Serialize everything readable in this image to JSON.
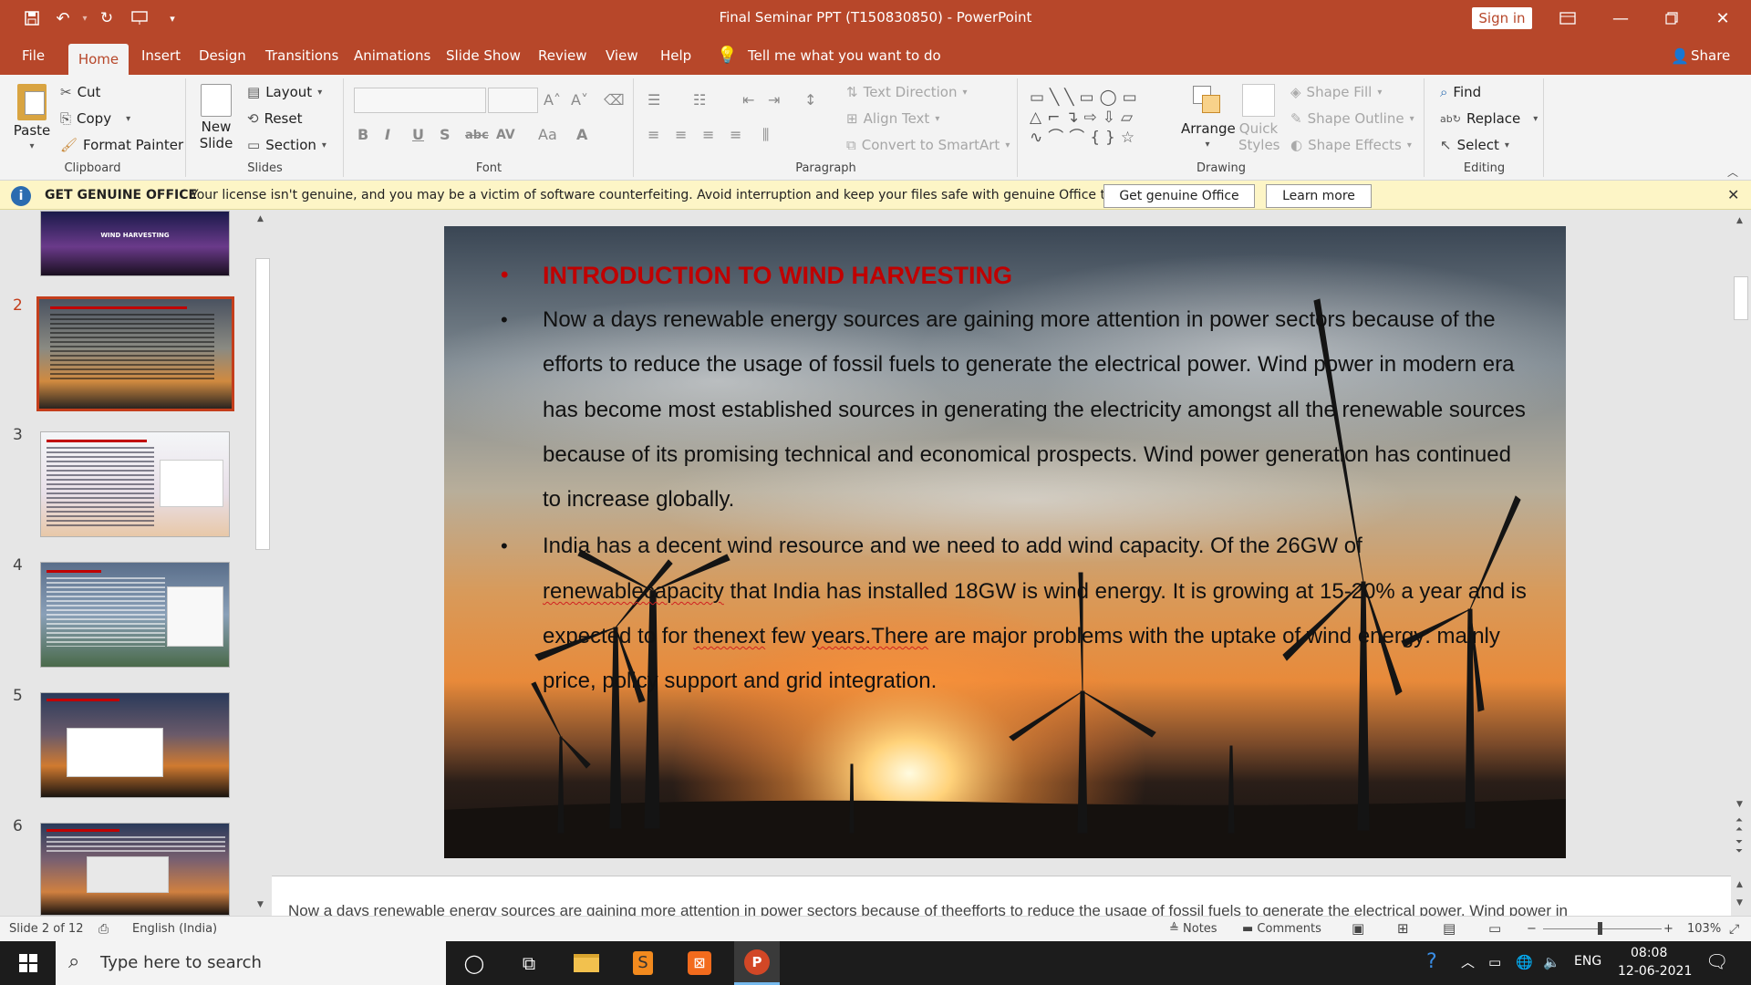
{
  "window": {
    "title": "Final Seminar PPT (T150830850)  -  PowerPoint",
    "sign_in": "Sign in",
    "quick_access": [
      "save-icon",
      "undo-icon",
      "redo-icon",
      "present-icon",
      "customize-icon"
    ]
  },
  "menu": {
    "tabs": [
      "File",
      "Home",
      "Insert",
      "Design",
      "Transitions",
      "Animations",
      "Slide Show",
      "Review",
      "View",
      "Help"
    ],
    "active": "Home",
    "tell_me": "Tell me what you want to do",
    "share": "Share"
  },
  "ribbon": {
    "clipboard": {
      "label": "Clipboard",
      "paste": "Paste",
      "cut": "Cut",
      "copy": "Copy",
      "format_painter": "Format Painter"
    },
    "slides": {
      "label": "Slides",
      "new_slide": "New Slide",
      "layout": "Layout",
      "reset": "Reset",
      "section": "Section"
    },
    "font": {
      "label": "Font"
    },
    "paragraph": {
      "label": "Paragraph",
      "text_direction": "Text Direction",
      "align_text": "Align Text",
      "convert_smartart": "Convert to SmartArt"
    },
    "drawing": {
      "label": "Drawing",
      "arrange": "Arrange",
      "quick_styles": "Quick Styles",
      "shape_fill": "Shape Fill",
      "shape_outline": "Shape Outline",
      "shape_effects": "Shape Effects"
    },
    "editing": {
      "label": "Editing",
      "find": "Find",
      "replace": "Replace",
      "select": "Select"
    }
  },
  "notice": {
    "title": "GET GENUINE OFFICE",
    "message": "Your license isn't genuine, and you may be a victim of software counterfeiting. Avoid interruption and keep your files safe with genuine Office today.",
    "btn_genuine": "Get genuine Office",
    "btn_learn": "Learn more"
  },
  "thumbnails": [
    {
      "num": "",
      "label": "WIND HARVESTING"
    },
    {
      "num": "2",
      "selected": true
    },
    {
      "num": "3"
    },
    {
      "num": "4"
    },
    {
      "num": "5"
    },
    {
      "num": "6"
    }
  ],
  "slide": {
    "title": "INTRODUCTION TO WIND HARVESTING",
    "para1": " Now a days renewable energy sources are gaining more attention in power sectors because of the efforts to reduce the usage of fossil fuels to generate the electrical power. Wind power in modern era has become most established sources in generating the electricity amongst all the renewable sources because of its promising technical and economical prospects. Wind power generation has continued to increase globally.",
    "para2_a": "India has a decent wind resource and we need to add wind capacity. Of the 26GW of ",
    "para2_sq1": "renewablecapacity",
    "para2_b": " that India has installed 18GW is wind energy. It is growing at 15-20% a year and is expected to for ",
    "para2_sq2": "thenext",
    "para2_c": " few ",
    "para2_sq3": "years.There",
    "para2_d": " are major problems with the uptake of wind energy: mainly price, policy support and grid integration."
  },
  "notes": {
    "text": "Now a days renewable energy sources are gaining more attention in power sectors because of theefforts to reduce the usage of fossil fuels to generate the electrical power. Wind power in"
  },
  "status": {
    "slide_of": "Slide 2 of 12",
    "language": "English (India)",
    "notes": "Notes",
    "comments": "Comments",
    "zoom": "103%"
  },
  "taskbar": {
    "search_placeholder": "Type here to search",
    "lang": "ENG",
    "time": "08:08",
    "date": "12-06-2021"
  }
}
